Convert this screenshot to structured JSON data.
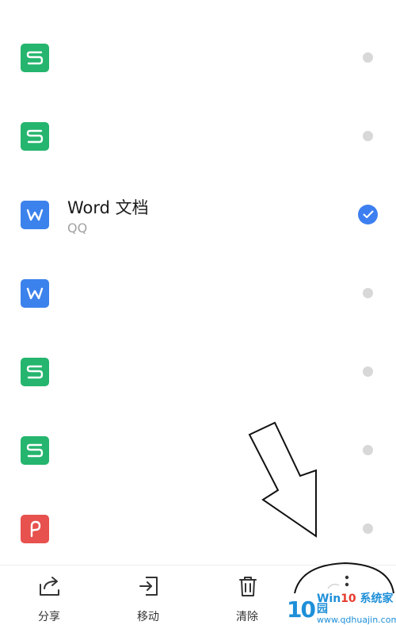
{
  "files": [
    {
      "type": "sheet",
      "icon": "spreadsheet-icon",
      "name": "",
      "source": "",
      "selected": false
    },
    {
      "type": "sheet",
      "icon": "spreadsheet-icon",
      "name": "",
      "source": "",
      "selected": false
    },
    {
      "type": "word",
      "icon": "word-doc-icon",
      "name": "Word 文档",
      "source": "QQ",
      "selected": true
    },
    {
      "type": "word",
      "icon": "word-doc-icon",
      "name": "",
      "source": "",
      "selected": false
    },
    {
      "type": "sheet",
      "icon": "spreadsheet-icon",
      "name": "",
      "source": "",
      "selected": false
    },
    {
      "type": "sheet",
      "icon": "spreadsheet-icon",
      "name": "",
      "source": "",
      "selected": false
    },
    {
      "type": "pdf",
      "icon": "pdf-icon",
      "name": "",
      "source": "",
      "selected": false
    }
  ],
  "bottom_bar": {
    "share": {
      "label": "分享",
      "icon": "share-icon"
    },
    "move": {
      "label": "移动",
      "icon": "move-icon"
    },
    "clear": {
      "label": "清除",
      "icon": "trash-icon"
    },
    "more": {
      "label": "",
      "icon": "more-vertical-icon"
    }
  },
  "colors": {
    "sheet": "#25b56e",
    "word": "#3c82ec",
    "pdf": "#e7514e",
    "selected": "#3d7ff0",
    "unselected": "#d8d8d8"
  },
  "watermark": {
    "logo": "10",
    "title_prefix": "Win",
    "title_num": "10",
    "title_suffix": " 系统家园",
    "url": "www.qdhuajin.com"
  }
}
